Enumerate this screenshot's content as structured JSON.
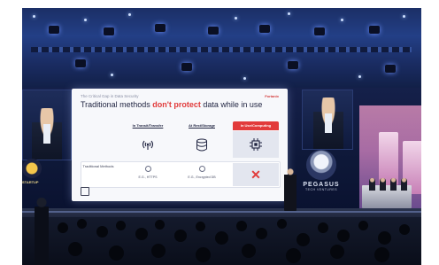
{
  "slide": {
    "eyebrow": "The Critical Gap in Data Security",
    "brand": "Fortanix",
    "heading_before": "Traditional methods ",
    "heading_highlight": "don't protect",
    "heading_after": " data while in use",
    "columns": [
      {
        "label": "In Transit/Transfer",
        "icon": "wifi-antenna-icon",
        "value": "E.G., HTTPS",
        "active": false
      },
      {
        "label": "At Rest/Storage",
        "icon": "database-icon",
        "value": "E.G., Encrypted DB",
        "active": false
      },
      {
        "label": "In Use/Computing",
        "icon": "cpu-chip-icon",
        "value": "✕",
        "active": true
      }
    ],
    "row_label": "Traditional Methods"
  },
  "colors": {
    "accent_red": "#e13b3b",
    "slide_bg": "#f7f8fb",
    "stage_blue": "#1b2f66",
    "glow_pink": "#c77fb6"
  },
  "brand_backdrop": {
    "name": "PEGASUS",
    "tagline": "TECH VENTURES"
  },
  "left_badge": "STARTUP"
}
